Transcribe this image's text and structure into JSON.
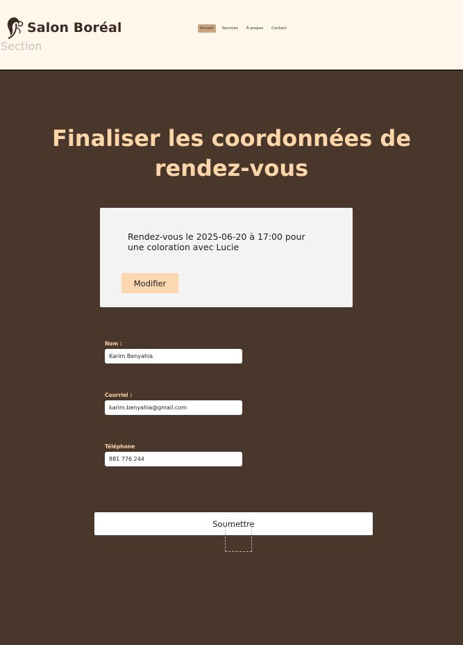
{
  "header": {
    "brand": "Salon Boréal",
    "ghost_label": "Section",
    "nav": [
      {
        "label": "Accueil",
        "active": true
      },
      {
        "label": "Services",
        "active": false
      },
      {
        "label": "À propos",
        "active": false
      },
      {
        "label": "Contact",
        "active": false
      }
    ]
  },
  "main": {
    "title": "Finaliser les coordonnées de rendez-vous",
    "summary": {
      "text": "Rendez-vous le 2025-06-20 à 17:00 pour une coloration avec Lucie",
      "modify_label": "Modifier"
    },
    "form": {
      "name_label": "Nom :",
      "name_value": "Karim Benyahia",
      "email_label": "Courriel :",
      "email_value": "karim.benyahia@gmail.com",
      "phone_label": "Téléphone",
      "phone_value": "881 776 244",
      "submit_label": "Soumettre"
    }
  },
  "colors": {
    "background": "#48372a",
    "header_bg": "#fff6ec",
    "accent": "#fcd5a8",
    "nav_active": "#c9a583"
  },
  "icons": {
    "logo": "hair-silhouette-icon"
  }
}
